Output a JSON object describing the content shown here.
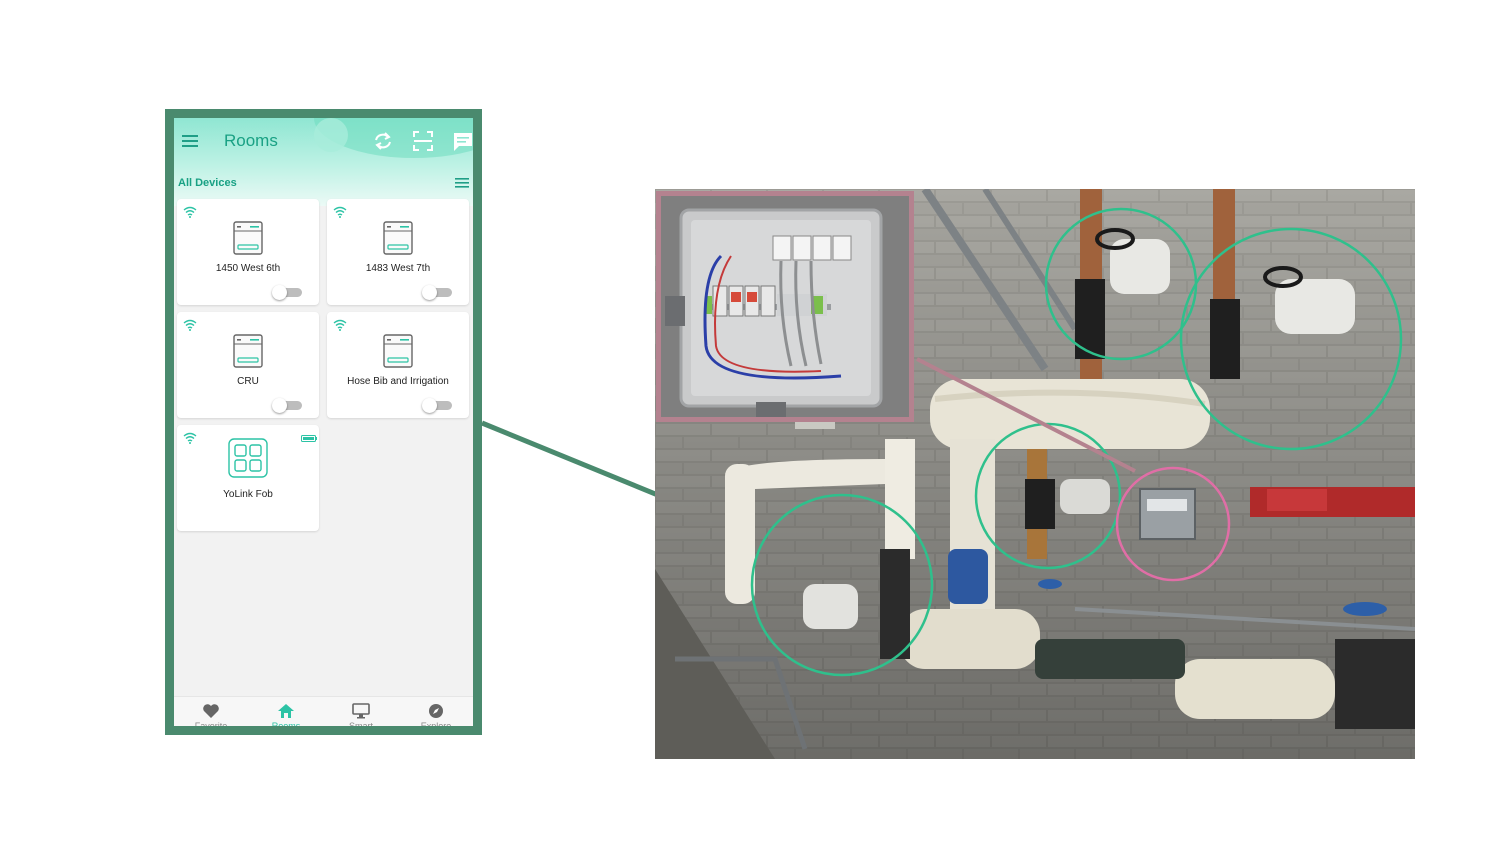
{
  "app": {
    "title": "Rooms",
    "section_title": "All Devices"
  },
  "devices": [
    {
      "name": "1450 West 6th",
      "type": "hub",
      "switch_on": false
    },
    {
      "name": "1483 West 7th",
      "type": "hub",
      "switch_on": false
    },
    {
      "name": "CRU",
      "type": "hub",
      "switch_on": false
    },
    {
      "name": "Hose Bib and Irrigation",
      "type": "hub",
      "switch_on": false
    },
    {
      "name": "YoLink Fob",
      "type": "fob"
    }
  ],
  "bottom_nav": [
    {
      "label": "Favorite",
      "icon": "heart-icon",
      "active": false
    },
    {
      "label": "Rooms",
      "icon": "home-icon",
      "active": true
    },
    {
      "label": "Smart",
      "icon": "monitor-icon",
      "active": false
    },
    {
      "label": "Explore",
      "icon": "compass-icon",
      "active": false
    }
  ],
  "colors": {
    "accent": "#2cc3a5",
    "frame": "#4a8a6e",
    "inset_border": "#b4828f",
    "valve_circle": "#2fc08c",
    "controller_circle": "#e06ea6"
  }
}
